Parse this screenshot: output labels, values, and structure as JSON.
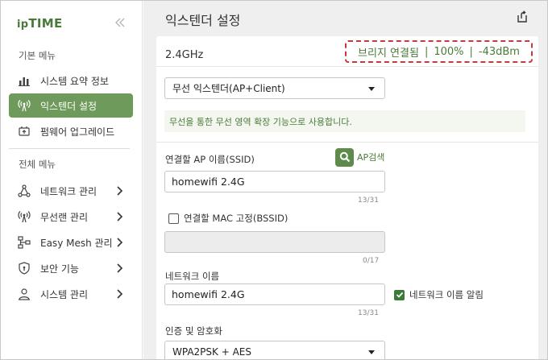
{
  "sidebar": {
    "logo_prefix": "ip",
    "logo_main": "TIME",
    "section_basic": "기본 메뉴",
    "basic_items": [
      {
        "label": "시스템 요약 정보"
      },
      {
        "label": "익스텐더 설정"
      },
      {
        "label": "펌웨어 업그레이드"
      }
    ],
    "section_all": "전체 메뉴",
    "all_items": [
      {
        "label": "네트워크 관리"
      },
      {
        "label": "무선랜 관리"
      },
      {
        "label": "Easy Mesh 관리"
      },
      {
        "label": "보안 기능"
      },
      {
        "label": "시스템 관리"
      }
    ]
  },
  "header": {
    "title": "익스텐더 설정"
  },
  "card": {
    "band": "2.4GHz",
    "status": {
      "state": "브리지 연결됨",
      "signal_percent": "100%",
      "rssi": "-43dBm",
      "color": "#4a7a3a",
      "border_color": "#c43b3b"
    },
    "mode_select": "무선 익스텐더(AP+Client)",
    "mode_info": "무선을 통한 무선 영역 확장 기능으로 사용합니다.",
    "ssid_label": "연결할 AP 이름(SSID)",
    "ap_search_label": "AP검색",
    "ssid_value": "homewifi 2.4G",
    "ssid_counter": "13/31",
    "mac_fix_label": "연결할 MAC 고정(BSSID)",
    "mac_value": "",
    "mac_counter": "0/17",
    "network_name_label": "네트워크 이름",
    "network_name_value": "homewifi 2.4G",
    "network_name_counter": "13/31",
    "network_name_broadcast_label": "네트워크 이름 알림",
    "auth_label": "인증 및 암호화",
    "auth_select": "WPA2PSK + AES"
  },
  "colors": {
    "accent": "#6e9a5b",
    "brand_green": "#4a7a3a",
    "checkbox_green": "#3c7a37"
  }
}
